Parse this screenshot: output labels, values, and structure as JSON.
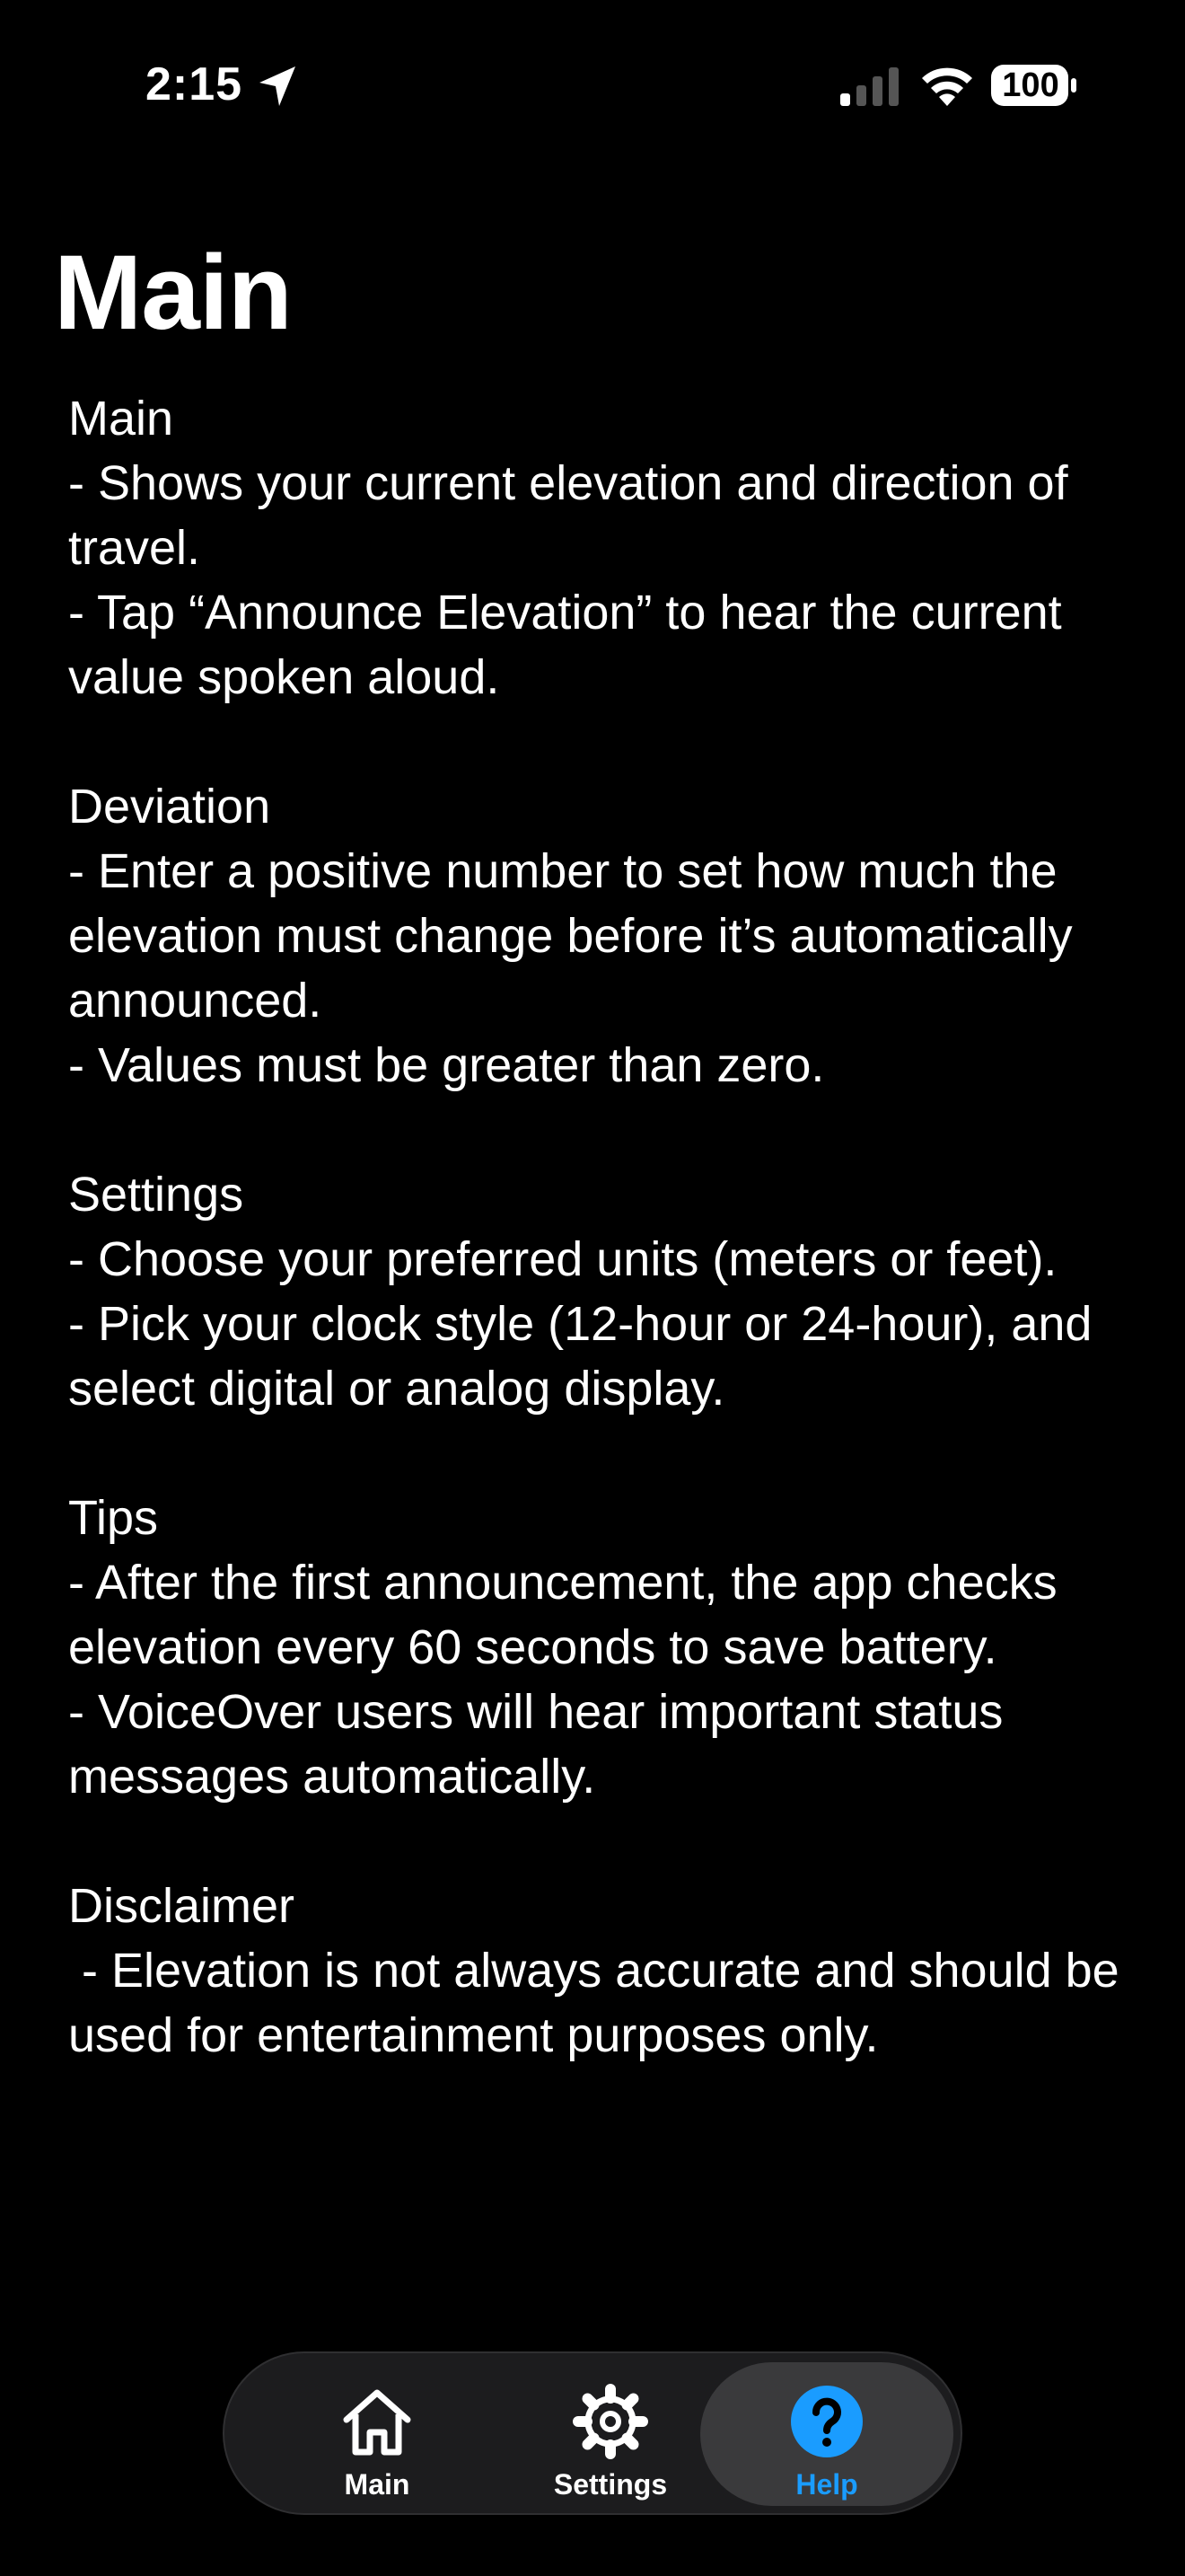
{
  "status_bar": {
    "time": "2:15",
    "location_icon": "location-arrow-icon",
    "signal_icon": "cellular-signal-icon",
    "wifi_icon": "wifi-icon",
    "battery_level": "100"
  },
  "page": {
    "title": "Main"
  },
  "help": {
    "sections": [
      {
        "heading": "Main",
        "lines": [
          "- Shows your current elevation and direction of travel.",
          "- Tap “Announce Elevation” to hear the current value spoken aloud."
        ]
      },
      {
        "heading": "Deviation",
        "lines": [
          "- Enter a positive number to set how much the elevation must change before it’s automatically announced.",
          "- Values must be greater than zero."
        ]
      },
      {
        "heading": "Settings",
        "lines": [
          "- Choose your preferred units (meters or feet).",
          "- Pick your clock style (12-hour or 24-hour), and select digital or analog display."
        ]
      },
      {
        "heading": "Tips",
        "lines": [
          "- After the first announcement, the app checks elevation every 60 seconds to save battery.",
          "- VoiceOver users will hear important status messages automatically."
        ]
      },
      {
        "heading": "Disclaimer",
        "lines": [
          " - Elevation is not always accurate and should be used for entertainment purposes only."
        ]
      }
    ]
  },
  "tab_bar": {
    "main_label": "Main",
    "main_icon": "house-icon",
    "settings_label": "Settings",
    "settings_icon": "gear-icon",
    "help_label": "Help",
    "help_icon": "question-circle-icon",
    "selected": "Help",
    "accent_color": "#1a9cff"
  }
}
